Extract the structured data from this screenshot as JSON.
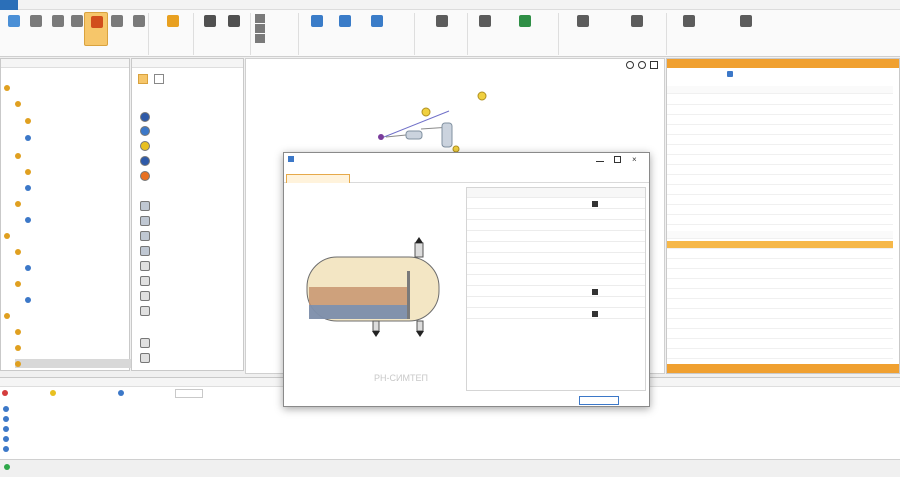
{
  "watermark": "РН-СИМТЕП",
  "icons": {
    "menu": "app-menu-icon",
    "ribbon": [
      "pvt-icon",
      "layers-icon",
      "tools-icon",
      "book-icon",
      "export-icon"
    ],
    "tree": [
      "folder-icon",
      "chevron-down-icon",
      "flask-icon",
      "plus-icon"
    ],
    "objects": [
      "source-icon",
      "well-icon",
      "sink-icon",
      "pump-icon",
      "separator-icon",
      "tank-icon",
      "valve-icon"
    ],
    "props": [
      "eye-icon",
      "settings-icon",
      "pin-icon",
      "close-icon"
    ],
    "dialog": [
      "minimize-icon",
      "maximize-icon",
      "close-icon"
    ],
    "journal": [
      "error-icon",
      "warning-icon",
      "message-icon"
    ]
  },
  "colors": {
    "accent_blue": "#2b6fb8",
    "active_button": "#f6c66a",
    "panel_orange": "#f0a030",
    "selection": "#d8d8d8",
    "dialog_tab": "#fff3dc"
  }
}
